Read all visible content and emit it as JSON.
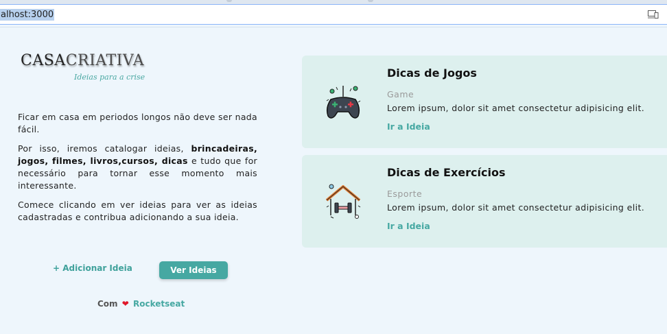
{
  "browser": {
    "url": "alhost:3000"
  },
  "logo": {
    "casa": "CASA",
    "criativa": "CRIATIVA",
    "tagline": "Ideias para a crise"
  },
  "intro": {
    "p1": "Ficar em casa em periodos longos não deve ser nada fácil.",
    "p2_prefix": "Por isso, iremos catalogar ideias, ",
    "p2_bold": "brincadeiras, jogos, filmes, livros,cursos, dicas",
    "p2_suffix": " e tudo que for necessário para tornar esse momento mais interessante.",
    "p3": "Comece clicando em ver ideias para ver as ideias cadastradas e contribua adicionando a sua ideia."
  },
  "actions": {
    "add_label": "+ Adicionar Ideia",
    "view_label": "Ver Ideias"
  },
  "credit": {
    "prefix": "Com",
    "heart": "❤",
    "brand": "Rocketseat"
  },
  "cards": [
    {
      "title": "Dicas de Jogos",
      "category": "Game",
      "description": "Lorem ipsum, dolor sit amet consectetur adipisicing elit.",
      "link": "Ir a Ideia",
      "icon": "gamepad-icon"
    },
    {
      "title": "Dicas de Exercícios",
      "category": "Esporte",
      "description": "Lorem ipsum, dolor sit amet consectetur adipisicing elit.",
      "link": "Ir a Ideia",
      "icon": "home-dumbbell-icon"
    }
  ],
  "colors": {
    "background": "#eef6fc",
    "card": "#ddf0ee",
    "accent": "#46a8a2",
    "heart": "#e0182a"
  }
}
